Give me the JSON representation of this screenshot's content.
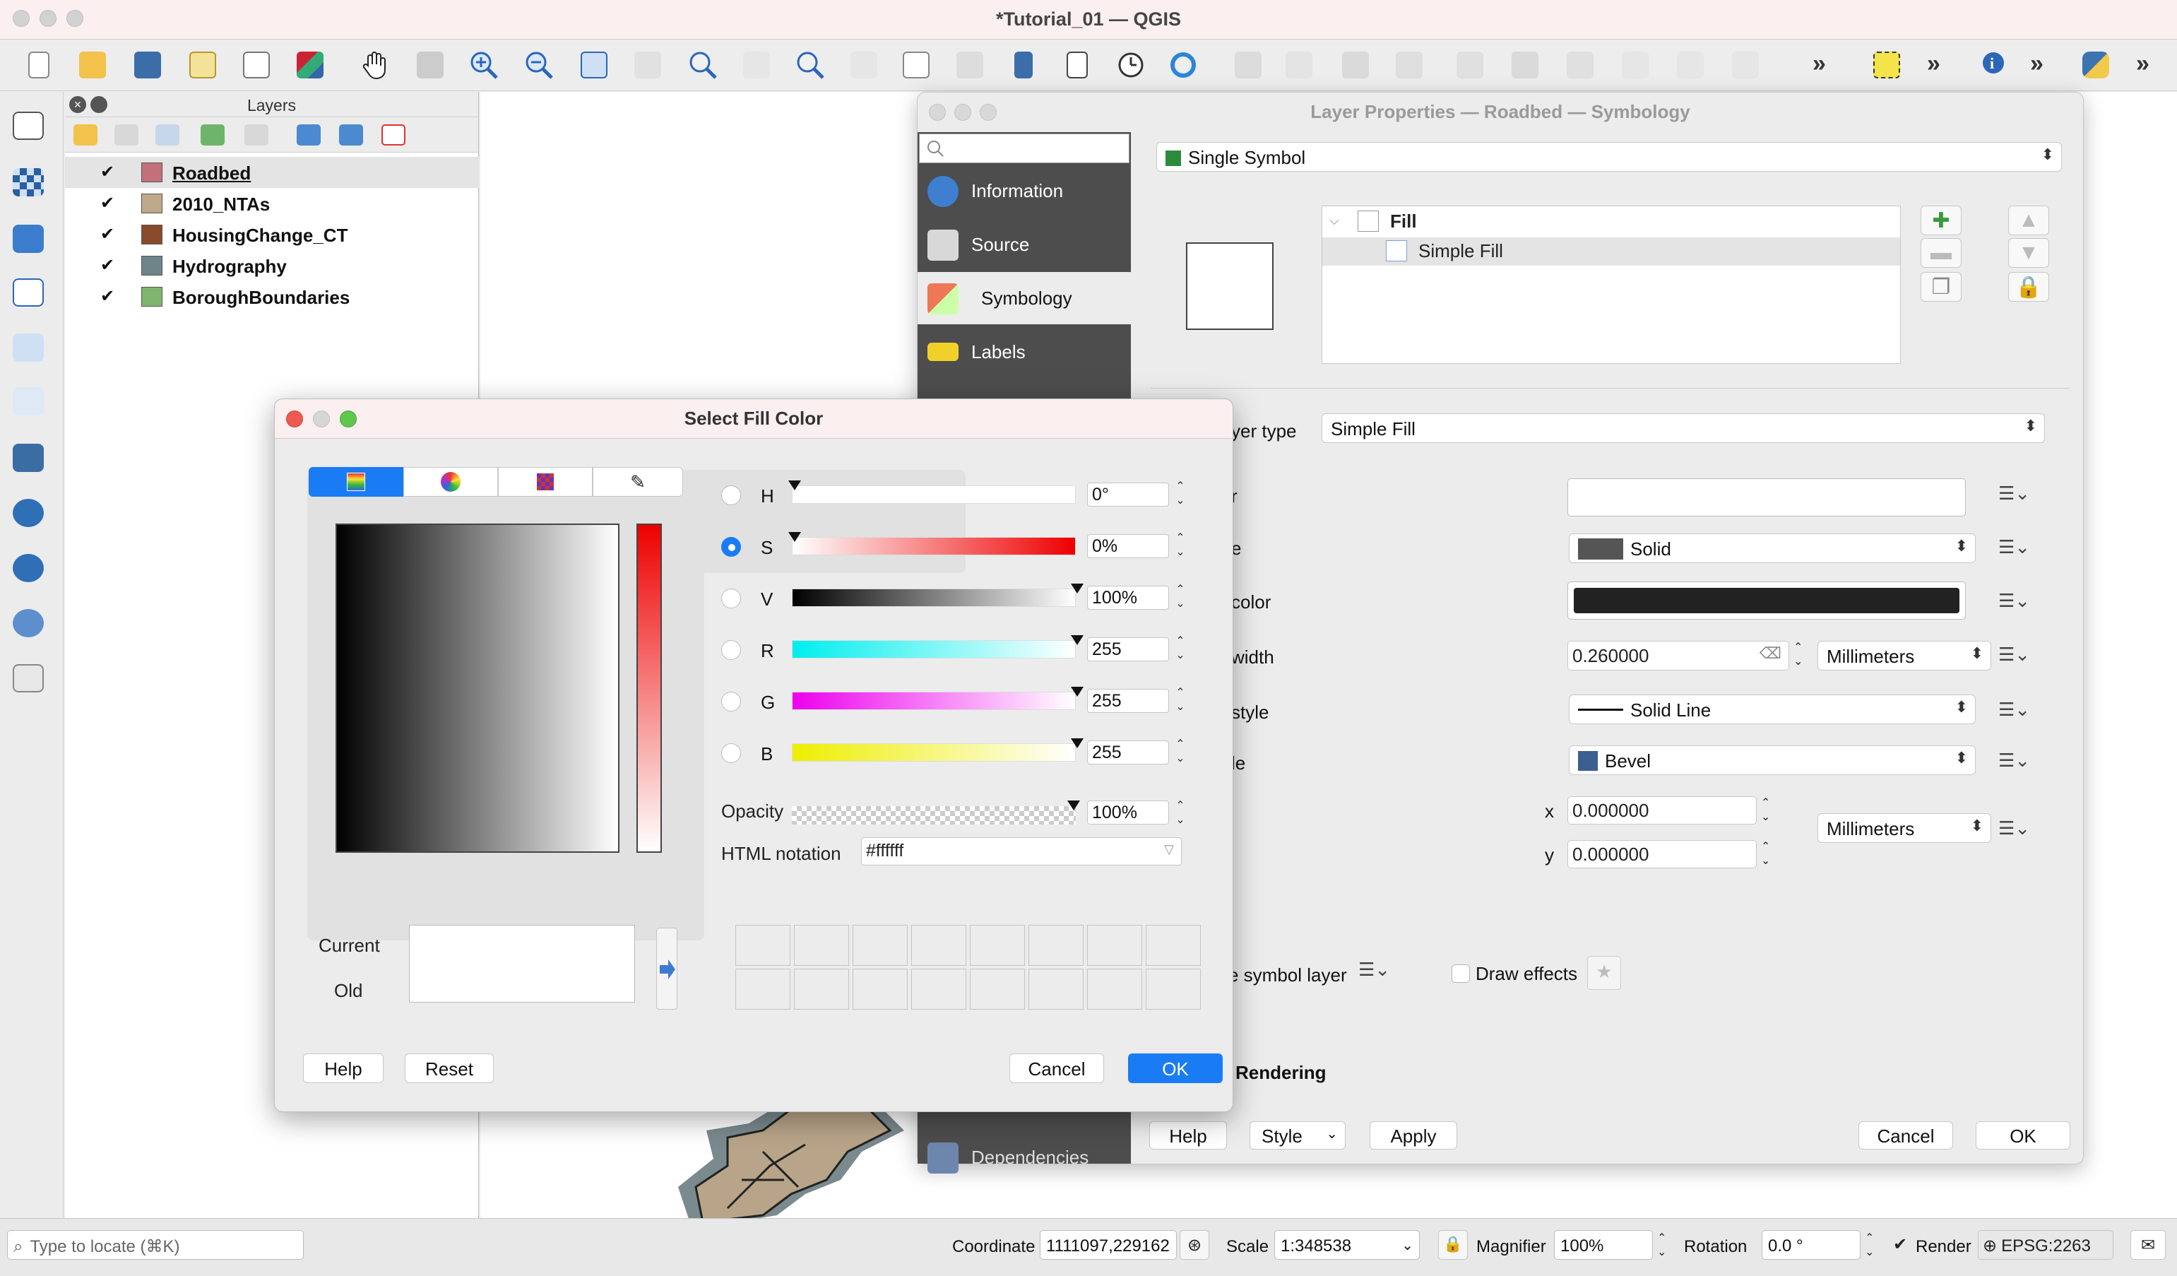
{
  "window": {
    "title": "*Tutorial_01 — QGIS"
  },
  "layers_panel": {
    "title": "Layers",
    "layers": [
      {
        "name": "Roadbed",
        "color": "#c4707a",
        "checked": true,
        "selected": true
      },
      {
        "name": "2010_NTAs",
        "color": "#c0a98a",
        "checked": true
      },
      {
        "name": "HousingChange_CT",
        "color": "#8a4a2c",
        "checked": true
      },
      {
        "name": "Hydrography",
        "color": "#6e8488",
        "checked": true
      },
      {
        "name": "BoroughBoundaries",
        "color": "#7fb56e",
        "checked": true
      }
    ]
  },
  "properties": {
    "title": "Layer Properties — Roadbed — Symbology",
    "sidebar": [
      {
        "label": "Information",
        "icon": "info-icon"
      },
      {
        "label": "Source",
        "icon": "tools-icon"
      },
      {
        "label": "Symbology",
        "icon": "brush-icon"
      },
      {
        "label": "Labels",
        "icon": "abc-icon"
      },
      {
        "label": "Dependencies",
        "icon": "dependencies-icon"
      }
    ],
    "renderer": "Single Symbol",
    "tree": {
      "root": "Fill",
      "child": "Simple Fill"
    },
    "layer_type_label": "yer type",
    "layer_type": "Simple Fill",
    "row_labels": {
      "fill": "r",
      "fill_style": "e",
      "stroke_color": "color",
      "stroke_width": "width",
      "stroke_style": "style",
      "join_style": "le",
      "offset_x": "x",
      "offset_y": "y"
    },
    "fill_style": "Solid",
    "stroke_width": "0.260000",
    "stroke_width_unit": "Millimeters",
    "stroke_style": "Solid Line",
    "join_style": "Bevel",
    "offset_x": "0.000000",
    "offset_y": "0.000000",
    "offset_unit": "Millimeters",
    "enable_symbol_layer": "e symbol layer",
    "draw_effects": "Draw effects",
    "rendering_label": "Rendering",
    "buttons": {
      "help": "Help",
      "style": "Style",
      "apply": "Apply",
      "cancel": "Cancel",
      "ok": "OK"
    }
  },
  "fill_dialog": {
    "title": "Select Fill Color",
    "channels": [
      {
        "label": "H",
        "value": "0°",
        "selected": false
      },
      {
        "label": "S",
        "value": "0%",
        "selected": true
      },
      {
        "label": "V",
        "value": "100%",
        "selected": false
      },
      {
        "label": "R",
        "value": "255",
        "selected": false
      },
      {
        "label": "G",
        "value": "255",
        "selected": false
      },
      {
        "label": "B",
        "value": "255",
        "selected": false
      }
    ],
    "opacity_label": "Opacity",
    "opacity_value": "100%",
    "html_label": "HTML notation",
    "html_value": "#ffffff",
    "current_label": "Current",
    "old_label": "Old",
    "buttons": {
      "help": "Help",
      "reset": "Reset",
      "cancel": "Cancel",
      "ok": "OK"
    }
  },
  "status": {
    "search_placeholder": "Type to locate (⌘K)",
    "coordinate_label": "Coordinate",
    "coordinate": "1111097,229162",
    "scale_label": "Scale",
    "scale": "1:348538",
    "magnifier_label": "Magnifier",
    "magnifier": "100%",
    "rotation_label": "Rotation",
    "rotation": "0.0 °",
    "render_label": "Render",
    "crs": "EPSG:2263"
  },
  "colors": {
    "accent": "#1a7cf5",
    "sidebar_bg": "#4d4d4d"
  }
}
